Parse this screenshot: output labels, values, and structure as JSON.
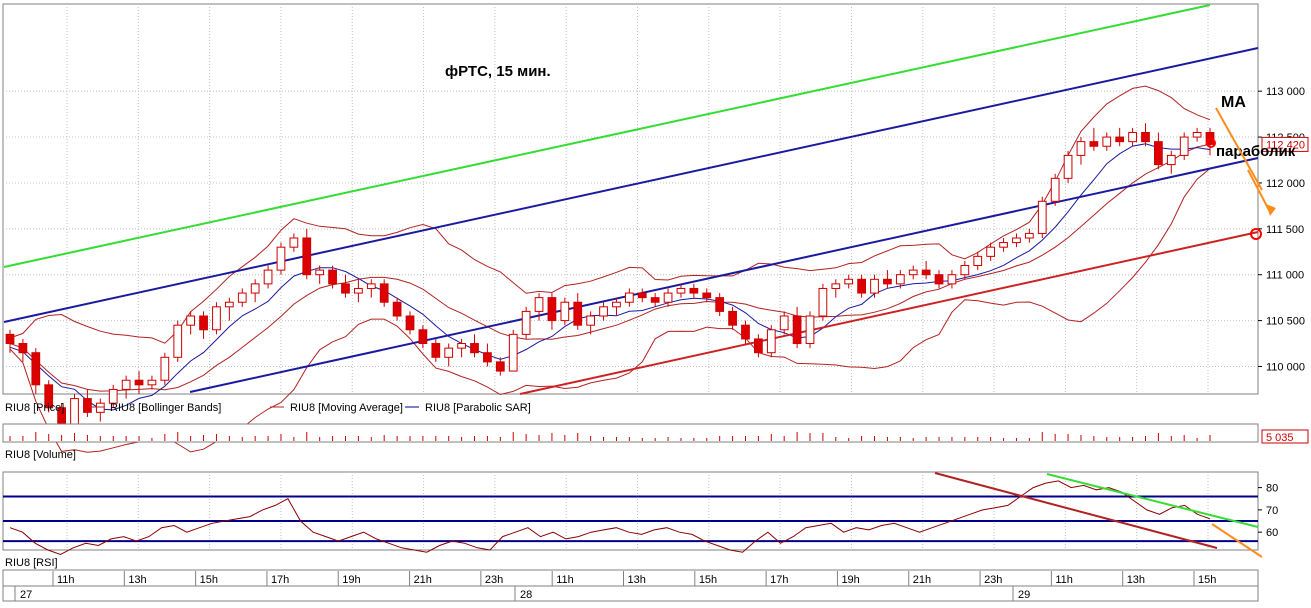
{
  "chart_data": {
    "type": "candlestick",
    "title": "фРТС, 15 мин.",
    "annotations": [
      "MA",
      "параболик"
    ],
    "price_panel": {
      "ylim": [
        109700,
        113950
      ],
      "y_ticks": [
        "113 000",
        "112 500",
        "112 000",
        "111 500",
        "111 000",
        "110 500",
        "110 000"
      ],
      "y_tick_values": [
        113000,
        112500,
        112000,
        111500,
        111000,
        110500,
        110000
      ],
      "last_price_label": "112 420",
      "last_price": 112420,
      "legend": [
        {
          "name": "RIU8 [Price]",
          "color": "#ff0000"
        },
        {
          "name": "RIU8 [Bollinger Bands]",
          "color": "#b22222"
        },
        {
          "name": "RIU8 [Moving Average]",
          "color": "#b22222"
        },
        {
          "name": "RIU8 [Parabolic SAR]",
          "color": "#00008b"
        }
      ],
      "candles_ohlc": [
        [
          110350,
          110400,
          110150,
          110250
        ],
        [
          110250,
          110300,
          110050,
          110150
        ],
        [
          110150,
          110200,
          109700,
          109800
        ],
        [
          109800,
          109850,
          109500,
          109550
        ],
        [
          109550,
          109600,
          109300,
          109350
        ],
        [
          109350,
          109700,
          109300,
          109650
        ],
        [
          109650,
          109750,
          109450,
          109500
        ],
        [
          109500,
          109650,
          109400,
          109600
        ],
        [
          109600,
          109800,
          109550,
          109750
        ],
        [
          109750,
          109900,
          109650,
          109850
        ],
        [
          109850,
          109950,
          109700,
          109800
        ],
        [
          109800,
          109900,
          109750,
          109850
        ],
        [
          109850,
          110150,
          109800,
          110100
        ],
        [
          110100,
          110500,
          110050,
          110450
        ],
        [
          110450,
          110600,
          110350,
          110550
        ],
        [
          110550,
          110600,
          110300,
          110400
        ],
        [
          110400,
          110700,
          110350,
          110650
        ],
        [
          110650,
          110750,
          110500,
          110700
        ],
        [
          110700,
          110850,
          110650,
          110800
        ],
        [
          110800,
          110950,
          110700,
          110900
        ],
        [
          110900,
          111100,
          110850,
          111050
        ],
        [
          111050,
          111350,
          111000,
          111300
        ],
        [
          111300,
          111450,
          111250,
          111400
        ],
        [
          111400,
          111500,
          110950,
          111000
        ],
        [
          111000,
          111100,
          110900,
          111050
        ],
        [
          111050,
          111100,
          110850,
          110900
        ],
        [
          110900,
          111000,
          110750,
          110800
        ],
        [
          110800,
          110950,
          110700,
          110850
        ],
        [
          110850,
          110950,
          110750,
          110900
        ],
        [
          110900,
          110950,
          110650,
          110700
        ],
        [
          110700,
          110750,
          110500,
          110550
        ],
        [
          110550,
          110600,
          110350,
          110400
        ],
        [
          110400,
          110450,
          110200,
          110250
        ],
        [
          110250,
          110300,
          110050,
          110100
        ],
        [
          110100,
          110250,
          110000,
          110200
        ],
        [
          110200,
          110300,
          110100,
          110250
        ],
        [
          110250,
          110350,
          110100,
          110150
        ],
        [
          110150,
          110250,
          110000,
          110050
        ],
        [
          110050,
          110100,
          109900,
          109950
        ],
        [
          109950,
          110400,
          109950,
          110350
        ],
        [
          110350,
          110650,
          110300,
          110600
        ],
        [
          110600,
          110800,
          110500,
          110750
        ],
        [
          110750,
          110800,
          110400,
          110500
        ],
        [
          110500,
          110750,
          110450,
          110700
        ],
        [
          110700,
          110800,
          110400,
          110450
        ],
        [
          110450,
          110600,
          110350,
          110550
        ],
        [
          110550,
          110700,
          110500,
          110650
        ],
        [
          110650,
          110750,
          110550,
          110700
        ],
        [
          110700,
          110850,
          110650,
          110800
        ],
        [
          110800,
          110850,
          110700,
          110750
        ],
        [
          110750,
          110800,
          110650,
          110700
        ],
        [
          110700,
          110850,
          110650,
          110800
        ],
        [
          110800,
          110900,
          110750,
          110850
        ],
        [
          110850,
          110900,
          110750,
          110800
        ],
        [
          110800,
          110850,
          110700,
          110750
        ],
        [
          110750,
          110800,
          110550,
          110600
        ],
        [
          110600,
          110650,
          110400,
          110450
        ],
        [
          110450,
          110500,
          110250,
          110300
        ],
        [
          110300,
          110350,
          110100,
          110150
        ],
        [
          110150,
          110450,
          110100,
          110400
        ],
        [
          110400,
          110600,
          110350,
          110550
        ],
        [
          110550,
          110650,
          110200,
          110250
        ],
        [
          110250,
          110600,
          110200,
          110550
        ],
        [
          110550,
          110900,
          110500,
          110850
        ],
        [
          110850,
          110950,
          110750,
          110900
        ],
        [
          110900,
          111000,
          110850,
          110950
        ],
        [
          110950,
          111000,
          110750,
          110800
        ],
        [
          110800,
          111000,
          110750,
          110950
        ],
        [
          110950,
          111050,
          110850,
          110900
        ],
        [
          110900,
          111050,
          110850,
          111000
        ],
        [
          111000,
          111100,
          110950,
          111050
        ],
        [
          111050,
          111150,
          110950,
          111000
        ],
        [
          111000,
          111050,
          110850,
          110900
        ],
        [
          110900,
          111050,
          110850,
          111000
        ],
        [
          111000,
          111150,
          110950,
          111100
        ],
        [
          111100,
          111250,
          111050,
          111200
        ],
        [
          111200,
          111350,
          111150,
          111300
        ],
        [
          111300,
          111400,
          111250,
          111350
        ],
        [
          111350,
          111450,
          111300,
          111400
        ],
        [
          111400,
          111500,
          111350,
          111450
        ],
        [
          111450,
          111850,
          111400,
          111800
        ],
        [
          111800,
          112100,
          111750,
          112050
        ],
        [
          112050,
          112350,
          112000,
          112300
        ],
        [
          112300,
          112500,
          112200,
          112450
        ],
        [
          112450,
          112600,
          112350,
          112400
        ],
        [
          112400,
          112550,
          112350,
          112500
        ],
        [
          112500,
          112600,
          112400,
          112450
        ],
        [
          112450,
          112600,
          112400,
          112550
        ],
        [
          112550,
          112650,
          112400,
          112450
        ],
        [
          112450,
          112550,
          112150,
          112200
        ],
        [
          112200,
          112350,
          112100,
          112300
        ],
        [
          112300,
          112550,
          112250,
          112500
        ],
        [
          112500,
          112600,
          112450,
          112550
        ],
        [
          112550,
          112600,
          112300,
          112420
        ]
      ],
      "lines_note": "green, dark-blue and dark-red trend channel lines drawn over price"
    },
    "volume_panel": {
      "label": "RIU8 [Volume]",
      "last_value_label": "5 035",
      "last_value": 5035
    },
    "rsi_panel": {
      "label": "RIU8 [RSI]",
      "ylim": [
        52,
        87
      ],
      "y_ticks": [
        "80",
        "70",
        "60"
      ],
      "y_tick_values": [
        80,
        70,
        60
      ],
      "levels": [
        76,
        65,
        56
      ],
      "values": [
        62,
        60,
        55,
        52,
        50,
        53,
        55,
        54,
        57,
        58,
        56,
        58,
        62,
        63,
        60,
        62,
        64,
        65,
        66,
        67,
        70,
        72,
        75,
        65,
        60,
        58,
        56,
        58,
        60,
        57,
        55,
        53,
        52,
        51,
        54,
        56,
        55,
        53,
        52,
        58,
        60,
        62,
        58,
        60,
        57,
        58,
        60,
        61,
        62,
        60,
        59,
        61,
        62,
        60,
        59,
        56,
        54,
        52,
        51,
        56,
        60,
        55,
        58,
        62,
        63,
        64,
        60,
        62,
        61,
        63,
        64,
        62,
        60,
        62,
        64,
        66,
        68,
        70,
        71,
        72,
        76,
        80,
        82,
        83,
        80,
        81,
        79,
        80,
        78,
        74,
        70,
        68,
        71,
        72,
        68,
        66
      ]
    },
    "x_axis": {
      "time_labels": [
        "11h",
        "13h",
        "15h",
        "17h",
        "19h",
        "21h",
        "23h",
        "11h",
        "13h",
        "15h",
        "17h",
        "19h",
        "21h",
        "23h",
        "11h",
        "13h",
        "15h"
      ],
      "date_labels": [
        "27",
        "28",
        "29"
      ]
    }
  }
}
